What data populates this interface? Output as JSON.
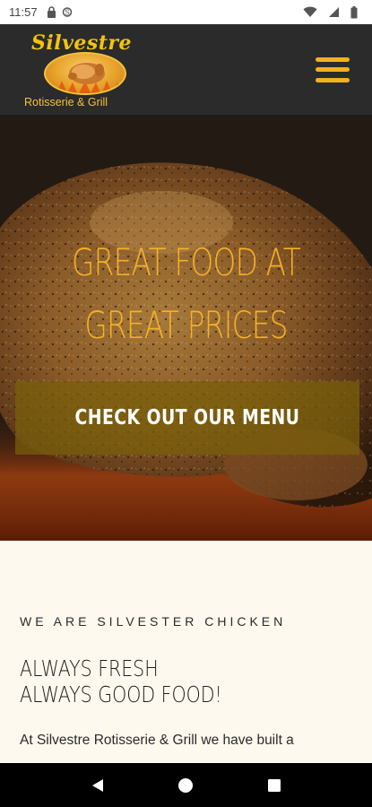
{
  "status_bar": {
    "time": "11:57",
    "icons": [
      "lock-icon",
      "sync-icon",
      "wifi-icon",
      "cell-signal-icon",
      "battery-icon"
    ]
  },
  "header": {
    "logo_script": "Silvestre",
    "logo_sub": "Rotisserie & Grill",
    "accent": "#f1b21f",
    "background": "#2b2b2b"
  },
  "hero": {
    "title_line1": "GREAT FOOD AT",
    "title_line2": "GREAT PRICES",
    "cta_label": "CHECK OUT OUR MENU",
    "title_color": "#f2b229"
  },
  "about": {
    "eyebrow": "WE ARE SILVESTER CHICKEN",
    "headline_line1": "ALWAYS FRESH",
    "headline_line2": "ALWAYS GOOD FOOD!",
    "body": "At Silvestre Rotisserie & Grill we have built a"
  },
  "nav_bar": {
    "buttons": [
      "back-icon",
      "home-icon",
      "recents-icon"
    ]
  }
}
